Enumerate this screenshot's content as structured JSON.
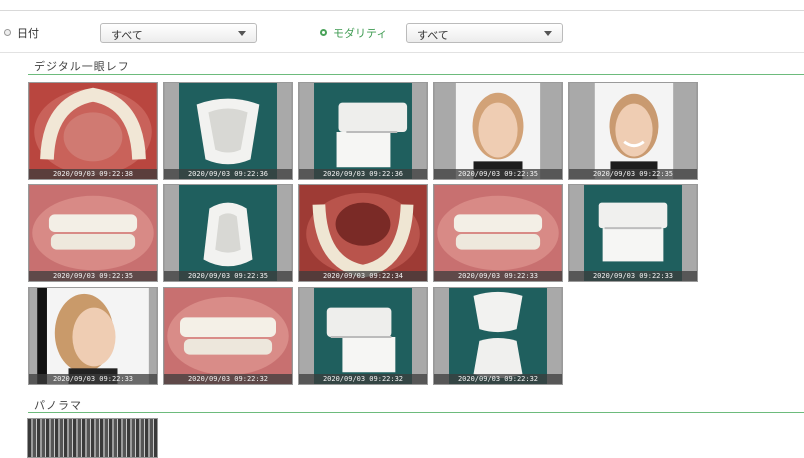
{
  "filters": {
    "date_label": "日付",
    "date_selected": false,
    "date_value": "すべて",
    "modality_label": "モダリティ",
    "modality_selected": true,
    "modality_value": "すべて"
  },
  "sections": [
    {
      "title": "デジタル一眼レフ",
      "thumbnails": [
        {
          "kind": "upper-occlusal-intraoral",
          "timestamp": "2020/09/03 09:22:38"
        },
        {
          "kind": "dental-model-occlusal",
          "timestamp": "2020/09/03 09:22:36"
        },
        {
          "kind": "dental-model-side",
          "timestamp": "2020/09/03 09:22:36"
        },
        {
          "kind": "face-front",
          "timestamp": "2020/09/03 09:22:35"
        },
        {
          "kind": "face-front-smile",
          "timestamp": "2020/09/03 09:22:35"
        },
        {
          "kind": "right-buccal-intraoral",
          "timestamp": "2020/09/03 09:22:35"
        },
        {
          "kind": "dental-model-lower-occlusal",
          "timestamp": "2020/09/03 09:22:35"
        },
        {
          "kind": "lower-occlusal-intraoral",
          "timestamp": "2020/09/03 09:22:34"
        },
        {
          "kind": "left-buccal-intraoral",
          "timestamp": "2020/09/03 09:22:33"
        },
        {
          "kind": "dental-model-front",
          "timestamp": "2020/09/03 09:22:33"
        },
        {
          "kind": "face-profile",
          "timestamp": "2020/09/03 09:22:33"
        },
        {
          "kind": "frontal-intraoral",
          "timestamp": "2020/09/03 09:22:32"
        },
        {
          "kind": "dental-model-side-2",
          "timestamp": "2020/09/03 09:22:32"
        },
        {
          "kind": "dental-model-open",
          "timestamp": "2020/09/03 09:22:32"
        }
      ]
    },
    {
      "title": "パノラマ",
      "thumbnails": [
        {
          "kind": "panoramic-xray",
          "timestamp": ""
        }
      ]
    }
  ],
  "colors": {
    "accent_green": "#4aa35a",
    "section_rule": "#6dbb7c",
    "model_background": "#1f5f5e"
  }
}
